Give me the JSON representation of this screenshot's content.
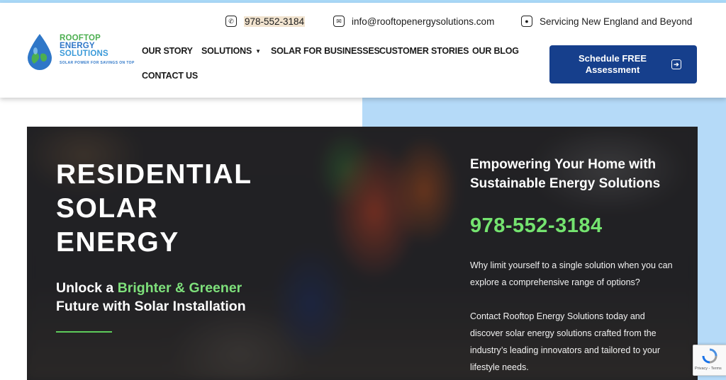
{
  "brand": {
    "line1": "ROOFTOP",
    "line2": "ENERGY",
    "line3": "SOLUTIONS",
    "tagline": "SOLAR POWER FOR SAVINGS ON TOP",
    "colors": {
      "green": "#4caf50",
      "blue": "#2f77c8",
      "navy": "#163f8c",
      "accent_green": "#7ee07b",
      "panel_blue": "#b5daf8"
    }
  },
  "contact": {
    "phone": "978-552-3184",
    "phone_icon": "phone-icon",
    "email": "info@rooftopenergysolutions.com",
    "email_icon": "mail-icon",
    "region": "Servicing New England and Beyond",
    "region_icon": "location-pin-icon"
  },
  "nav": {
    "our_story": "OUR STORY",
    "solutions": "SOLUTIONS",
    "solar_for_businesses": "SOLAR FOR BUSINESSES",
    "customer_stories": "CUSTOMER STORIES",
    "our_blog": "OUR BLOG",
    "contact_us": "CONTACT US"
  },
  "cta": {
    "line1": "Schedule FREE",
    "line2": "Assessment",
    "icon": "arrow-right-box-icon"
  },
  "hero": {
    "title_line1": "RESIDENTIAL",
    "title_line2": "SOLAR",
    "title_line3": "ENERGY",
    "sub_prefix": "Unlock a ",
    "sub_highlight": "Brighter & Greener",
    "sub_line2": "Future with Solar Installation",
    "headline_line1": "Empowering Your Home with",
    "headline_line2": "Sustainable Energy Solutions",
    "phone": "978-552-3184",
    "para1": "Why limit yourself to a single solution when you can explore a comprehensive range of options?",
    "para2": "Contact Rooftop Energy Solutions today and discover solar energy solutions crafted from the industry’s leading innovators and tailored to your lifestyle needs."
  },
  "recaptcha": {
    "label": "Privacy - Terms"
  }
}
